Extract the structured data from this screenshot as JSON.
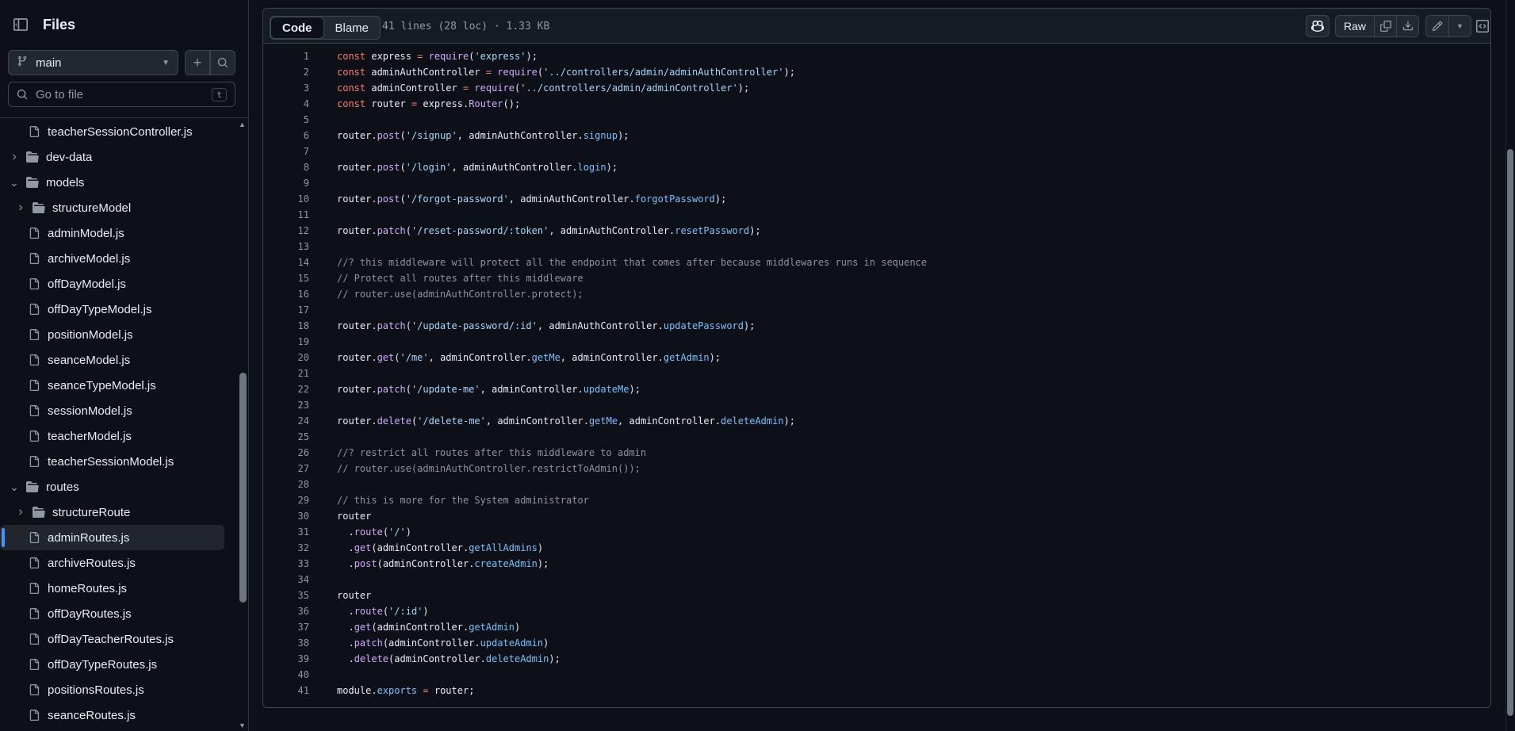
{
  "sidebar": {
    "title": "Files",
    "branch": "main",
    "search_placeholder": "Go to file",
    "search_shortcut": "t",
    "tree": [
      {
        "name": "teacherSessionController.js",
        "type": "file",
        "depth": 1
      },
      {
        "name": "dev-data",
        "type": "folder",
        "depth": 0,
        "expanded": false
      },
      {
        "name": "models",
        "type": "folder",
        "depth": 0,
        "expanded": true
      },
      {
        "name": "structureModel",
        "type": "folder",
        "depth": 1,
        "expanded": false
      },
      {
        "name": "adminModel.js",
        "type": "file",
        "depth": 1
      },
      {
        "name": "archiveModel.js",
        "type": "file",
        "depth": 1
      },
      {
        "name": "offDayModel.js",
        "type": "file",
        "depth": 1
      },
      {
        "name": "offDayTypeModel.js",
        "type": "file",
        "depth": 1
      },
      {
        "name": "positionModel.js",
        "type": "file",
        "depth": 1
      },
      {
        "name": "seanceModel.js",
        "type": "file",
        "depth": 1
      },
      {
        "name": "seanceTypeModel.js",
        "type": "file",
        "depth": 1
      },
      {
        "name": "sessionModel.js",
        "type": "file",
        "depth": 1
      },
      {
        "name": "teacherModel.js",
        "type": "file",
        "depth": 1
      },
      {
        "name": "teacherSessionModel.js",
        "type": "file",
        "depth": 1
      },
      {
        "name": "routes",
        "type": "folder",
        "depth": 0,
        "expanded": true
      },
      {
        "name": "structureRoute",
        "type": "folder",
        "depth": 1,
        "expanded": false
      },
      {
        "name": "adminRoutes.js",
        "type": "file",
        "depth": 1,
        "selected": true
      },
      {
        "name": "archiveRoutes.js",
        "type": "file",
        "depth": 1
      },
      {
        "name": "homeRoutes.js",
        "type": "file",
        "depth": 1
      },
      {
        "name": "offDayRoutes.js",
        "type": "file",
        "depth": 1
      },
      {
        "name": "offDayTeacherRoutes.js",
        "type": "file",
        "depth": 1
      },
      {
        "name": "offDayTypeRoutes.js",
        "type": "file",
        "depth": 1
      },
      {
        "name": "positionsRoutes.js",
        "type": "file",
        "depth": 1
      },
      {
        "name": "seanceRoutes.js",
        "type": "file",
        "depth": 1
      }
    ]
  },
  "toolbar": {
    "code_tab": "Code",
    "blame_tab": "Blame",
    "file_meta": "41 lines (28 loc) · 1.33 KB",
    "raw_label": "Raw"
  },
  "code_lines": [
    [
      [
        "k",
        "const"
      ],
      [
        "t",
        " express "
      ],
      [
        "k",
        "="
      ],
      [
        "t",
        " "
      ],
      [
        "f",
        "require"
      ],
      [
        "t",
        "("
      ],
      [
        "s",
        "'express'"
      ],
      [
        "t",
        ");"
      ]
    ],
    [
      [
        "k",
        "const"
      ],
      [
        "t",
        " adminAuthController "
      ],
      [
        "k",
        "="
      ],
      [
        "t",
        " "
      ],
      [
        "f",
        "require"
      ],
      [
        "t",
        "("
      ],
      [
        "s",
        "'../controllers/admin/adminAuthController'"
      ],
      [
        "t",
        ");"
      ]
    ],
    [
      [
        "k",
        "const"
      ],
      [
        "t",
        " adminController "
      ],
      [
        "k",
        "="
      ],
      [
        "t",
        " "
      ],
      [
        "f",
        "require"
      ],
      [
        "t",
        "("
      ],
      [
        "s",
        "'../controllers/admin/adminController'"
      ],
      [
        "t",
        ");"
      ]
    ],
    [
      [
        "k",
        "const"
      ],
      [
        "t",
        " router "
      ],
      [
        "k",
        "="
      ],
      [
        "t",
        " express."
      ],
      [
        "f",
        "Router"
      ],
      [
        "t",
        "();"
      ]
    ],
    [],
    [
      [
        "t",
        "router."
      ],
      [
        "f",
        "post"
      ],
      [
        "t",
        "("
      ],
      [
        "s",
        "'/signup'"
      ],
      [
        "t",
        ", adminAuthController."
      ],
      [
        "p",
        "signup"
      ],
      [
        "t",
        ");"
      ]
    ],
    [],
    [
      [
        "t",
        "router."
      ],
      [
        "f",
        "post"
      ],
      [
        "t",
        "("
      ],
      [
        "s",
        "'/login'"
      ],
      [
        "t",
        ", adminAuthController."
      ],
      [
        "p",
        "login"
      ],
      [
        "t",
        ");"
      ]
    ],
    [],
    [
      [
        "t",
        "router."
      ],
      [
        "f",
        "post"
      ],
      [
        "t",
        "("
      ],
      [
        "s",
        "'/forgot-password'"
      ],
      [
        "t",
        ", adminAuthController."
      ],
      [
        "p",
        "forgotPassword"
      ],
      [
        "t",
        ");"
      ]
    ],
    [],
    [
      [
        "t",
        "router."
      ],
      [
        "f",
        "patch"
      ],
      [
        "t",
        "("
      ],
      [
        "s",
        "'/reset-password/:token'"
      ],
      [
        "t",
        ", adminAuthController."
      ],
      [
        "p",
        "resetPassword"
      ],
      [
        "t",
        ");"
      ]
    ],
    [],
    [
      [
        "c",
        "//? this middleware will protect all the endpoint that comes after because middlewares runs in sequence"
      ]
    ],
    [
      [
        "c",
        "// Protect all routes after this middleware"
      ]
    ],
    [
      [
        "c",
        "// router.use(adminAuthController.protect);"
      ]
    ],
    [],
    [
      [
        "t",
        "router."
      ],
      [
        "f",
        "patch"
      ],
      [
        "t",
        "("
      ],
      [
        "s",
        "'/update-password/:id'"
      ],
      [
        "t",
        ", adminAuthController."
      ],
      [
        "p",
        "updatePassword"
      ],
      [
        "t",
        ");"
      ]
    ],
    [],
    [
      [
        "t",
        "router."
      ],
      [
        "f",
        "get"
      ],
      [
        "t",
        "("
      ],
      [
        "s",
        "'/me'"
      ],
      [
        "t",
        ", adminController."
      ],
      [
        "p",
        "getMe"
      ],
      [
        "t",
        ", adminController."
      ],
      [
        "p",
        "getAdmin"
      ],
      [
        "t",
        ");"
      ]
    ],
    [],
    [
      [
        "t",
        "router."
      ],
      [
        "f",
        "patch"
      ],
      [
        "t",
        "("
      ],
      [
        "s",
        "'/update-me'"
      ],
      [
        "t",
        ", adminController."
      ],
      [
        "p",
        "updateMe"
      ],
      [
        "t",
        ");"
      ]
    ],
    [],
    [
      [
        "t",
        "router."
      ],
      [
        "f",
        "delete"
      ],
      [
        "t",
        "("
      ],
      [
        "s",
        "'/delete-me'"
      ],
      [
        "t",
        ", adminController."
      ],
      [
        "p",
        "getMe"
      ],
      [
        "t",
        ", adminController."
      ],
      [
        "p",
        "deleteAdmin"
      ],
      [
        "t",
        ");"
      ]
    ],
    [],
    [
      [
        "c",
        "//? restrict all routes after this middleware to admin"
      ]
    ],
    [
      [
        "c",
        "// router.use(adminAuthController.restrictToAdmin());"
      ]
    ],
    [],
    [
      [
        "c",
        "// this is more for the System administrator"
      ]
    ],
    [
      [
        "t",
        "router"
      ]
    ],
    [
      [
        "t",
        "  ."
      ],
      [
        "f",
        "route"
      ],
      [
        "t",
        "("
      ],
      [
        "s",
        "'/'"
      ],
      [
        "t",
        ")"
      ]
    ],
    [
      [
        "t",
        "  ."
      ],
      [
        "f",
        "get"
      ],
      [
        "t",
        "(adminController."
      ],
      [
        "p",
        "getAllAdmins"
      ],
      [
        "t",
        ")"
      ]
    ],
    [
      [
        "t",
        "  ."
      ],
      [
        "f",
        "post"
      ],
      [
        "t",
        "(adminController."
      ],
      [
        "p",
        "createAdmin"
      ],
      [
        "t",
        ");"
      ]
    ],
    [],
    [
      [
        "t",
        "router"
      ]
    ],
    [
      [
        "t",
        "  ."
      ],
      [
        "f",
        "route"
      ],
      [
        "t",
        "("
      ],
      [
        "s",
        "'/:id'"
      ],
      [
        "t",
        ")"
      ]
    ],
    [
      [
        "t",
        "  ."
      ],
      [
        "f",
        "get"
      ],
      [
        "t",
        "(adminController."
      ],
      [
        "p",
        "getAdmin"
      ],
      [
        "t",
        ")"
      ]
    ],
    [
      [
        "t",
        "  ."
      ],
      [
        "f",
        "patch"
      ],
      [
        "t",
        "(adminController."
      ],
      [
        "p",
        "updateAdmin"
      ],
      [
        "t",
        ")"
      ]
    ],
    [
      [
        "t",
        "  ."
      ],
      [
        "f",
        "delete"
      ],
      [
        "t",
        "(adminController."
      ],
      [
        "p",
        "deleteAdmin"
      ],
      [
        "t",
        ");"
      ]
    ],
    [],
    [
      [
        "t",
        "module."
      ],
      [
        "p",
        "exports"
      ],
      [
        "t",
        " "
      ],
      [
        "k",
        "="
      ],
      [
        "t",
        " router;"
      ]
    ]
  ]
}
